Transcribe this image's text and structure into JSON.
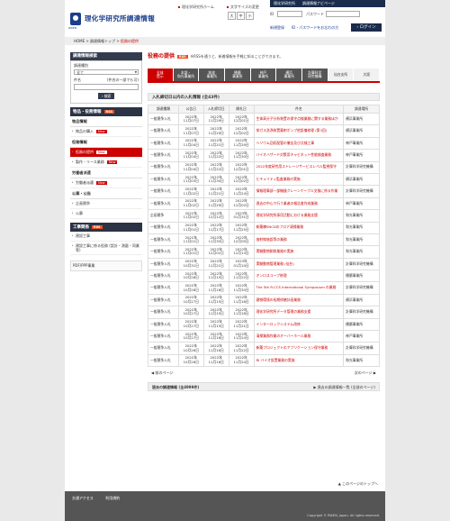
{
  "header": {
    "logo_text": "理化学研究所調達情報",
    "logo_en": "RIKEN",
    "home_link": "理化学研究所ホーム",
    "fontsize_label": "文字サイズの変更",
    "fontsize_buttons": [
      "大",
      "中",
      "小"
    ],
    "darkbar": [
      "理化学研究所",
      "調達情報ナビページ"
    ],
    "id_label": "ID",
    "pw_label": "パスワード",
    "newreg": "新規登録",
    "forgot": "ID・パスワードをお忘れの方",
    "login": "ログイン"
  },
  "breadcrumb": [
    "HOME",
    "調達情報トップ",
    "役務の提供"
  ],
  "sidebar": {
    "search_title": "調達情報検索",
    "type_label": "調達種別",
    "type_value": "全て",
    "kw_label": "件名",
    "kw_hint": "(件名の一部でも可)",
    "search_btn": "検索",
    "cat_title": "物品・役務情報",
    "rss": "RSS",
    "sections": [
      {
        "label": "物品情報",
        "items": [
          {
            "label": "物品の購入",
            "new": "New"
          }
        ]
      },
      {
        "label": "役務情報",
        "items": [
          {
            "label": "役務の提供",
            "new": "New",
            "active": true
          },
          {
            "label": "製作・リース業務",
            "new": "New"
          }
        ]
      },
      {
        "label": "労働者派遣",
        "items": [
          {
            "label": "労働者派遣",
            "new": "New"
          }
        ]
      },
      {
        "label": "公募・公告",
        "items": [
          {
            "label": "企画競争",
            "new": ""
          },
          {
            "label": "公募",
            "new": ""
          }
        ]
      }
    ],
    "work_title": "工事関係",
    "work_items": [
      "建設工事",
      "建設工事に係る役務 (設計・測量・同業等)"
    ],
    "pdf": "PDF/PPP事業"
  },
  "main": {
    "title": "役務の提供",
    "rss": "RSS",
    "desc": "※RSSを通うと、新着情報を手軽に知ることができます。",
    "tabs": [
      "全体\n提示",
      "本部・\n和光事業所",
      "筑波\n事業所",
      "播磨\n事業所",
      "神戸\n事業所",
      "横浜\n事業所",
      "計算科学\n研究機構",
      "仙台支所",
      "大阪"
    ],
    "section": "入札締切日以内の入札情報 (全43件)",
    "columns": [
      "調達種類",
      "公告日",
      "入札締切日",
      "開札日",
      "件名",
      "調達場所"
    ],
    "rows": [
      [
        "一般競争入札",
        "2022年\n11月07日",
        "2022年\n11月29日",
        "2022年\n12月01日",
        "生体高分子分析装置の保守点検業務に関する業務ほか",
        "横浜事業所"
      ],
      [
        "一般競争入札",
        "2022年\n11月07日",
        "2022年\n11月29日",
        "2022年\n12月02日",
        "排ガス洗浄装置薬剤ポンプ他設備修理 (第3回)",
        "横浜事業所"
      ],
      [
        "一般競争入札",
        "2022年\n11月04日",
        "2022年\n11月21日",
        "2022年\n11月29日",
        "ヘリウム回収配管の撤去及び点検工事",
        "神戸事業所"
      ],
      [
        "一般競争入札",
        "2022年\n11月04日",
        "2022年\n11月22日",
        "2022年\n11月30日",
        "バイオハザード対策用キャビネット性能検査業務",
        "神戸事業所"
      ],
      [
        "一般競争入札",
        "2022年\n11月04日",
        "2022年\n11月22日",
        "2022年\n12月01日",
        "2022年度研究用ストレージサービスレベル監視保守",
        "計算科学研究機構"
      ],
      [
        "一般競争入札",
        "2022年\n11月03日",
        "2022年\n11月30日",
        "2022年\n12月02日",
        "ヒキュリティ監査業務の実施",
        "横浜事業所"
      ],
      [
        "一般競争入札",
        "2022年\n11月02日",
        "2022年\n11月21日",
        "2022年\n11月24日",
        "情報理事部一部機器クレーンケーブル交換に係る作業",
        "計算科学研究機構"
      ],
      [
        "一般競争入札",
        "2022年\n11月02日",
        "2022年\n11月29日",
        "2022年\n12月02日",
        "過去の中心で行う業者の報告書作成業務",
        "神戸事業所"
      ],
      [
        "企画競争",
        "2022年\n11月02日",
        "2022年\n12月12日",
        "2023年\n01月31日",
        "理化学研究所採用活動における業務支援",
        "和光事業所"
      ],
      [
        "一般競争入札",
        "2022年\n11月01日",
        "2022年\n11月17日",
        "2022年\n11月25日",
        "新築棟SNCDのフロア清掃業務",
        "和光事業所"
      ],
      [
        "一般競争入札",
        "2022年\n11月01日",
        "2022年\n11月30日",
        "2022年\n12月05日",
        "放射線施設等の業務",
        "和光事業所"
      ],
      [
        "一般競争入札",
        "2022年\n11月01日",
        "2022年\n12月01日",
        "2022年\n12月13日",
        "実験動物飼育業務の実施",
        "和光事業所"
      ],
      [
        "一般競争入札",
        "2022年\n10月31日",
        "2022年\n11月21日",
        "2023年\n01月10日",
        "実験動物管理業務 (仙台)",
        "計算科学研究機構"
      ],
      [
        "一般競争入札",
        "2022年\n10月28日",
        "2022年\n11月15日",
        "2022年\n11月22日",
        "オンロスコープ修理",
        "播磨事業所"
      ],
      [
        "一般競争入札",
        "2022年\n10月28日",
        "2022年\n11月16日",
        "2022年\n11月30日",
        "The 5th R-CCS International Symposium の業務",
        "計算科学研究機構"
      ],
      [
        "一般競争入札",
        "2022年\n10月27日",
        "2022年\n11月15日",
        "2022年\n11月16日",
        "建物環境の長期修繕計画業務",
        "横浜事業所"
      ],
      [
        "一般競争入札",
        "2022年\n10月27日",
        "2022年\n11月15日",
        "2022年\n11月18日",
        "理化学研究所データ管理の業務支援",
        "計算科学研究機構"
      ],
      [
        "一般競争入札",
        "2022年\n10月27日",
        "2022年\n11月15日",
        "2022年\n11月21日",
        "インターロックシステム改修",
        "播磨事業所"
      ],
      [
        "一般競争入札",
        "2022年\n10月27日",
        "2022年\n11月16日",
        "2022年\n11月24日",
        "清掃業務作業のオーバーホール業務",
        "神戸事業所"
      ],
      [
        "一般競争入札",
        "2022年\n10月26日",
        "2022年\n11月16日",
        "2022年\n11月22日",
        "新築プロジェクトのアプリケーション保守業務",
        "計算科学研究機構"
      ],
      [
        "一般競争入札",
        "2022年\n10月26日",
        "2022年\n11月16日",
        "2022年\n11月24日",
        "RI バイオ設置業務の実施",
        "和光事業所"
      ]
    ],
    "prev": "◀ 前のページ",
    "next": "次のページ ▶",
    "past_left": "過去の調達情報 (全4999件)",
    "past_right": "▶ 過去の調達情報一覧 (全部のページ)"
  },
  "totop": "▲ このページのトップへ",
  "footer": {
    "links": [
      "交通アクセス",
      "利用規約"
    ],
    "copyright": "Copyright © RIKEN, Japan. All rights reserved."
  }
}
